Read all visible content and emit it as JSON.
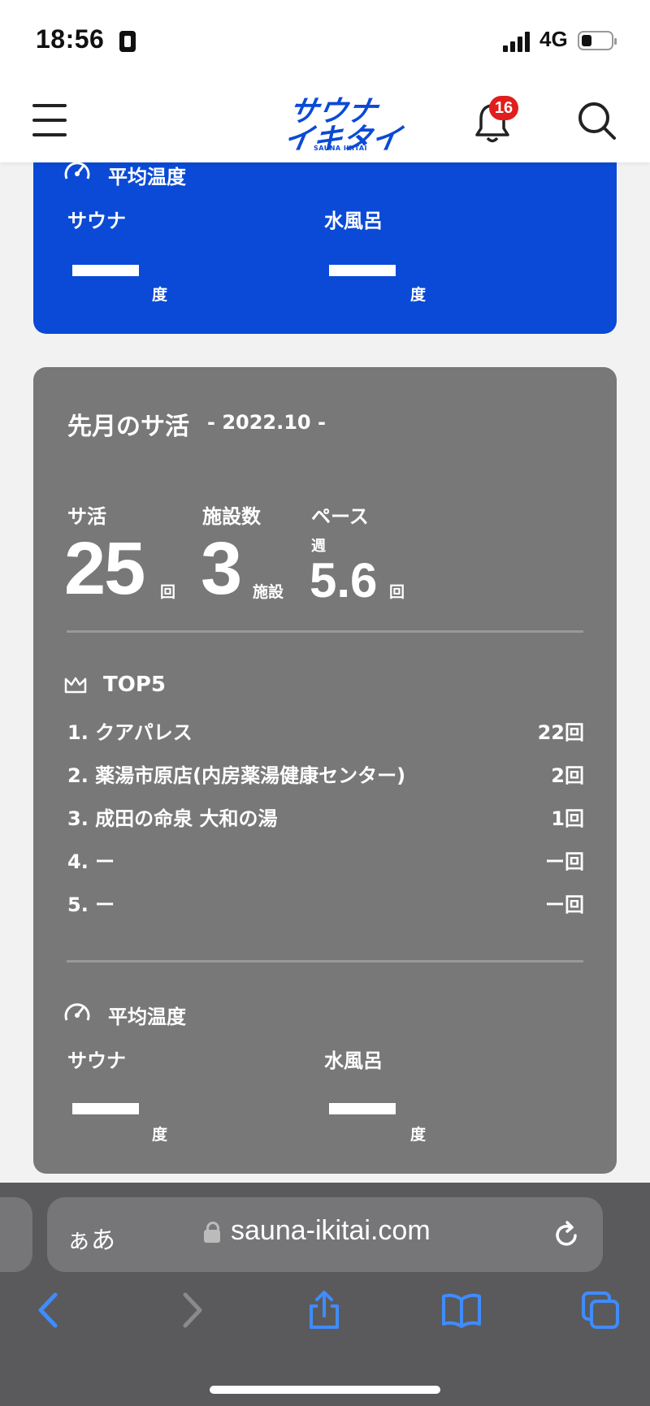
{
  "status": {
    "time": "18:56",
    "network": "4G"
  },
  "header": {
    "notification_count": "16",
    "logo_main_1": "サウナ",
    "logo_main_2": "イキタイ",
    "logo_sub": "SAUNA IKITAI"
  },
  "current_month": {
    "avg_temp_title": "平均温度",
    "sauna_label": "サウナ",
    "sauna_value": "ー",
    "sauna_unit": "度",
    "water_label": "水風呂",
    "water_value": "ー",
    "water_unit": "度"
  },
  "last_month": {
    "title": "先月のサ活",
    "period": "- 2022.10 -",
    "stats": {
      "count_label": "サ活",
      "count_value": "25",
      "count_unit": "回",
      "facilities_label": "施設数",
      "facilities_value": "3",
      "facilities_unit": "施設",
      "pace_label": "ペース",
      "pace_prefix": "週",
      "pace_value": "5.6",
      "pace_unit": "回"
    },
    "top5_title": "TOP5",
    "top5": [
      {
        "rank": "1. クアパレス",
        "count": "22回"
      },
      {
        "rank": "2. 薬湯市原店(内房薬湯健康センター)",
        "count": "2回"
      },
      {
        "rank": "3. 成田の命泉 大和の湯",
        "count": "1回"
      },
      {
        "rank": "4. ー",
        "count": "ー回"
      },
      {
        "rank": "5. ー",
        "count": "ー回"
      }
    ],
    "avg_temp_title": "平均温度",
    "sauna_label": "サウナ",
    "sauna_unit": "度",
    "water_label": "水風呂",
    "water_unit": "度"
  },
  "browser": {
    "aa_label": "ぁあ",
    "url": "sauna-ikitai.com"
  },
  "colors": {
    "brand_blue": "#0a4ad6",
    "card_gray": "#787878",
    "badge_red": "#e11d1d"
  }
}
